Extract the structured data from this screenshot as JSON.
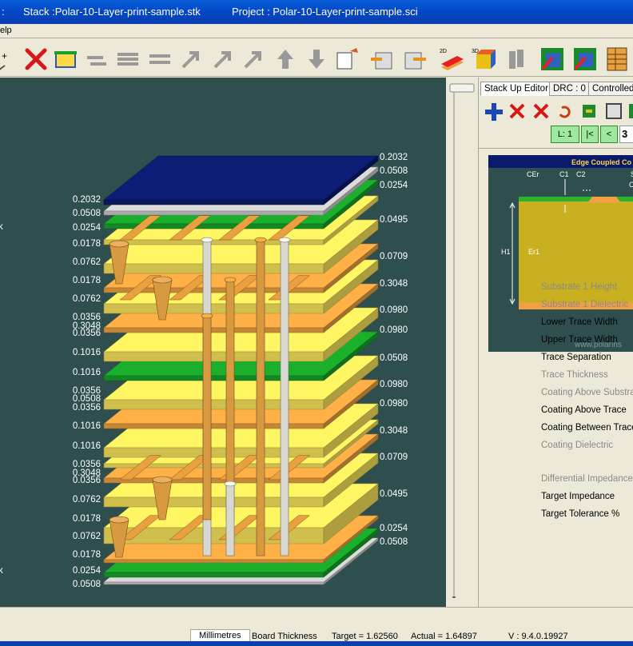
{
  "titlebar": {
    "prefix": ":",
    "stack": "Stack :Polar-10-Layer-print-sample.stk",
    "project": "Project : Polar-10-Layer-print-sample.sci"
  },
  "menubar": {
    "help": "elp"
  },
  "canvas": {
    "left_labels": [
      "0.2032",
      "0.0508",
      "0.0254",
      "0.0178",
      "0.0762",
      "0.0178",
      "0.0762",
      "0.0356",
      "0.3048",
      "0.0356",
      "0.1016",
      "0.1016",
      "0.0356",
      "0.0508",
      "0.0356",
      "0.1016",
      "0.1016",
      "0.0356",
      "0.3048",
      "0.0356",
      "0.0762",
      "0.0178",
      "0.0762",
      "0.0178",
      "0.0254",
      "0.0508"
    ],
    "right_labels": [
      "0.2032",
      "0.0508",
      "0.0254",
      "0.0495",
      "0.0709",
      "0.3048",
      "0.0980",
      "0.0980",
      "0.0508",
      "0.0980",
      "0.0980",
      "0.3048",
      "0.0709",
      "0.0495",
      "0.0254",
      "0.0508"
    ],
    "edge_labels": [
      "k",
      "k"
    ]
  },
  "right_panel": {
    "tabs": [
      "Stack Up Editor",
      "DRC : 0",
      "Controlled"
    ],
    "nav": {
      "layer": "L: 1",
      "first": "|<",
      "prev": "<",
      "number": "3"
    },
    "diagram": {
      "title": "Edge Coupled Co",
      "labels": {
        "cer": "CEr",
        "c1": "C1",
        "c2": "C2",
        "h1": "H1",
        "er1": "Er1",
        "s": "S",
        "c": "C"
      },
      "watermark": "www.polarins"
    },
    "params": [
      {
        "label": "Substrate 1 Height",
        "dim": true
      },
      {
        "label": "Substrate 1 Dielectric",
        "dim": true
      },
      {
        "label": "Lower Trace Width",
        "dim": false
      },
      {
        "label": "Upper Trace Width",
        "dim": false
      },
      {
        "label": "Trace Separation",
        "dim": false
      },
      {
        "label": "Trace Thickness",
        "dim": true
      },
      {
        "label": "Coating Above Substrat",
        "dim": true
      },
      {
        "label": "Coating Above Trace",
        "dim": false
      },
      {
        "label": "Coating Between Trace",
        "dim": false
      },
      {
        "label": "Coating Dielectric",
        "dim": true
      },
      {
        "label": "Differential Impedance",
        "dim": true
      },
      {
        "label": "Target Impedance",
        "dim": false
      },
      {
        "label": "Target Tolerance %",
        "dim": false
      }
    ]
  },
  "statusbar": {
    "units": "Millimetres",
    "metric": "Board Thickness",
    "target": "Target =  1.62560",
    "actual": "Actual =  1.64897",
    "version": "V : 9.4.0.19927"
  },
  "colors": {
    "canvas_bg": "#2f4f4f",
    "titlebar": "#0a5fd8",
    "prepreg": "#f5e05a",
    "copper": "#e8a040",
    "soldermask": "#18a028",
    "topcoat": "#0a1a6a"
  }
}
